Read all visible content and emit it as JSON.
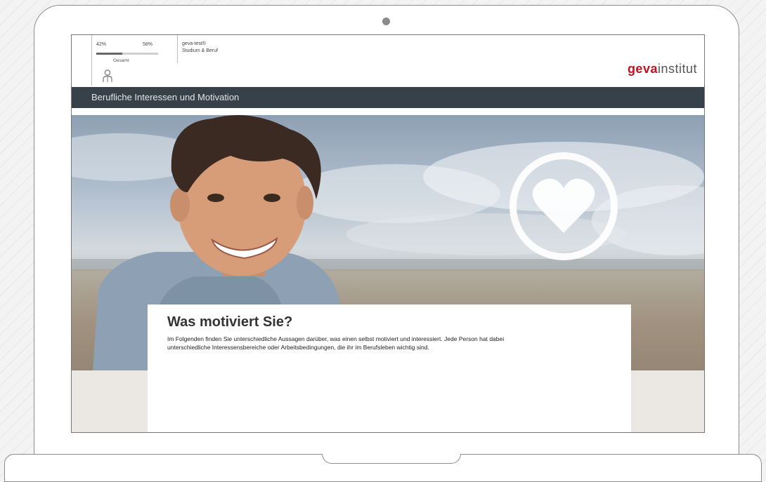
{
  "progress": {
    "left_percent_label": "42%",
    "right_percent_label": "58%",
    "caption": "Gesamt",
    "fraction": 0.42
  },
  "account": {
    "line1": "geva-test®",
    "line2": "Studium & Beruf"
  },
  "logo": {
    "part1": "geva",
    "part2": "institut"
  },
  "section_title": "Berufliche Interessen und Motivation",
  "card": {
    "heading": "Was motiviert Sie?",
    "body": "Im Folgenden finden Sie unterschiedliche Aussagen darüber, was einen selbst motiviert und interessiert. Jede Person hat dabei unterschiedliche Interessensbereiche oder Arbeitsbedingungen, die ihr im Berufsleben wichtig sind."
  },
  "icons": [
    "user-icon",
    "heart-icon"
  ],
  "colors": {
    "brand_red": "#c0111f",
    "section_bar": "#36414a",
    "page_band": "#ebe7e3"
  }
}
